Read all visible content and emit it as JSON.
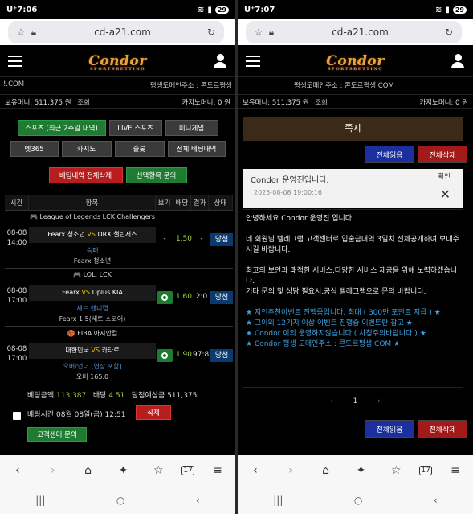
{
  "left": {
    "status": {
      "time": "7:06",
      "carrier": "U⁺",
      "battery": "29"
    },
    "url": "cd-a21.com",
    "logo": "Condor",
    "logo_sub": "SPORTSBETTING",
    "marquee_left": "!.COM",
    "marquee_right": "평생도메인주소 : 콘도르평생",
    "money": {
      "label": "보유머니:",
      "value": "511,375 원",
      "link": "조회",
      "casino": "카지노머니: 0 원"
    },
    "buttons_row1": [
      "스포츠 (최근 2주일 내역)",
      "LIVE 스포츠",
      "미니게임"
    ],
    "buttons_row2": [
      "벳365",
      "카지노",
      "슬롯",
      "전체 베팅내역"
    ],
    "delete_all": "베팅내역 전체삭제",
    "inquiry_selected": "선택항목 문의",
    "table_headers": [
      "시간",
      "항목",
      "보기",
      "배당",
      "결과",
      "상태"
    ],
    "bets": [
      {
        "league": "🎮 League of Legends LCK Challengers",
        "date": "08-08",
        "time": "14:00",
        "home": "Fearx 청소년",
        "vs": "VS",
        "away": "DRX 챌린저스",
        "pick_type": "승패",
        "pick": "Fearx 청소년",
        "see": "-",
        "odds": "1.50",
        "result": "-",
        "status": "당첨"
      },
      {
        "league": "🎮 LOL. LCK",
        "date": "08-08",
        "time": "17:00",
        "home": "Fearx",
        "vs": "VS",
        "away": "Dplus KIA",
        "pick_type": "세트 핸디캡",
        "pick": "Fearx  1.5(세트 스코어)",
        "see": "",
        "odds": "1.60",
        "result": "2:0",
        "status": "당첨"
      },
      {
        "league": "🏀 FIBA 아시안컵",
        "date": "08-08",
        "time": "17:00",
        "home": "대한민국",
        "vs": "VS",
        "away": "카타르",
        "pick_type": "오버/언더 [연장 포함]",
        "pick": "오버  165.0",
        "see": "",
        "odds": "1.90",
        "result": "97:83",
        "status": "당첨"
      }
    ],
    "summary": {
      "bet_label": "베팅금액",
      "bet_value": "113,387",
      "odds_label": "배당",
      "odds_value": "4.51",
      "win_label": "당첨예상금",
      "win_value": "511,375",
      "time_label": "베팅시간",
      "time_value": "08월 08일(금) 12:51",
      "delete": "삭제",
      "support": "고객센터 문의"
    }
  },
  "right": {
    "status": {
      "time": "7:07",
      "carrier": "U⁺",
      "battery": "29"
    },
    "url": "cd-a21.com",
    "logo": "Condor",
    "logo_sub": "SPORTSBETTING",
    "marquee": "평생도메인주소 : 콘도르평생.COM",
    "money": {
      "label": "보유머니:",
      "value": "511,375 원",
      "link": "조회",
      "casino": "카지노머니: 0 원"
    },
    "title": "쪽지",
    "read_all": "전체읽음",
    "delete_all": "전체삭제",
    "msg_title": "Condor 운영진입니다.",
    "msg_date": "2025-08-08 19:00:16",
    "confirm": "확인",
    "close": "✕",
    "body": [
      "안녕하세요 Condor 운영진 입니다.",
      "네 회원님 텔레그램 고객센터로 입출금내역 3일치 전체공개하여 보내주시길 바랍니다.",
      "최고의 보안과 쾌적한 서비스,다양한 서비스 제공을 위해 노력하겠습니다.",
      "기타 문의 및 상담 필요시,공식 텔레그램으로 문의 바랍니다."
    ],
    "promos": [
      "★ 지인추천이벤트 진행중입니다. 최대 ( 300만 포인트 지급 ) ★",
      "★ 그이외 12가지 이상 이벤트 진행중 이벤트란 참고 ★",
      "★ Condor 이외 운영하지않습니다 ( 사칭주의바랍니다 ) ★",
      "★ Condor 평생 도메인주소 : 콘도르평생.COM ★"
    ],
    "pager": {
      "prev": "‹",
      "page": "1",
      "next": "›"
    }
  },
  "nav": {
    "back": "‹",
    "forward": "›",
    "home": "⌂",
    "ai": "✦",
    "bookmark": "☆",
    "tabs": "17",
    "menu": "≡"
  },
  "sysnav": {
    "recent": "|||",
    "home": "○",
    "back": "‹"
  }
}
